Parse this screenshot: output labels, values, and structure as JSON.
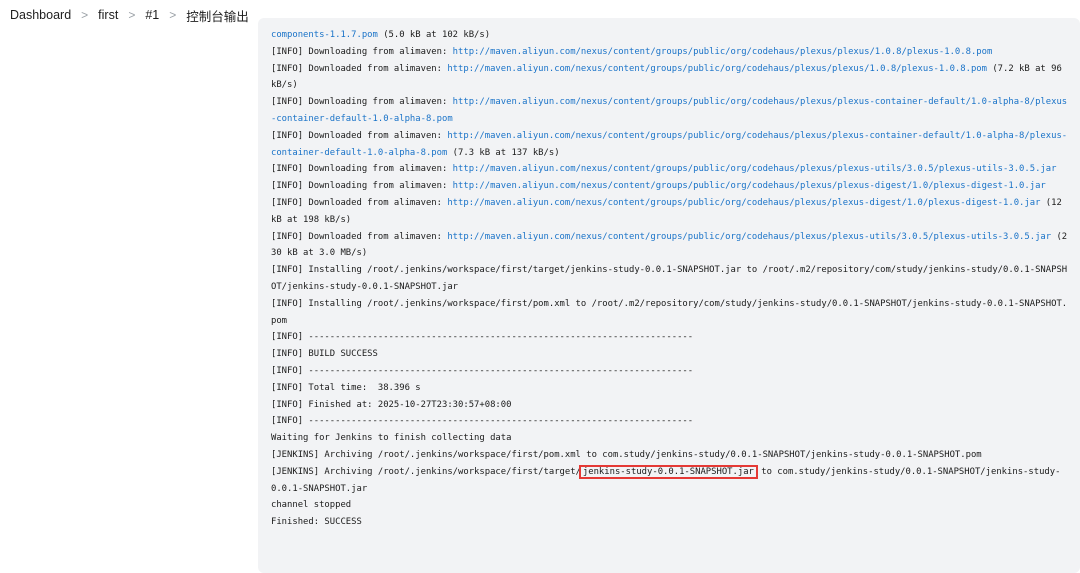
{
  "breadcrumb": {
    "items": [
      "Dashboard",
      "first",
      "#1",
      "控制台输出"
    ],
    "separator": ">"
  },
  "console": {
    "colors": {
      "text": "#1b1b1b",
      "link": "#1a73c8",
      "highlight": "#e53935",
      "panel_bg": "#f2f3f5"
    },
    "lines": [
      [
        {
          "a": "components-1.1.7.pom"
        },
        {
          "t": " (5.0 kB at 102 kB/s)"
        }
      ],
      [
        {
          "t": "[INFO] Downloading from alimaven: "
        },
        {
          "a": "http://maven.aliyun.com/nexus/content/groups/public/org/codehaus/plexus/plexus/1.0.8/plexus-1.0.8.pom"
        }
      ],
      [
        {
          "t": "[INFO] Downloaded from alimaven: "
        },
        {
          "a": "http://maven.aliyun.com/nexus/content/groups/public/org/codehaus/plexus/plexus/1.0.8/plexus-1.0.8.pom"
        },
        {
          "t": " (7.2 kB at 96 kB/s)"
        }
      ],
      [
        {
          "t": "[INFO] Downloading from alimaven: "
        },
        {
          "a": "http://maven.aliyun.com/nexus/content/groups/public/org/codehaus/plexus/plexus-container-default/1.0-alpha-8/plexus-container-default-1.0-alpha-8.pom"
        }
      ],
      [
        {
          "t": "[INFO] Downloaded from alimaven: "
        },
        {
          "a": "http://maven.aliyun.com/nexus/content/groups/public/org/codehaus/plexus/plexus-container-default/1.0-alpha-8/plexus-container-default-1.0-alpha-8.pom"
        },
        {
          "t": " (7.3 kB at 137 kB/s)"
        }
      ],
      [
        {
          "t": "[INFO] Downloading from alimaven: "
        },
        {
          "a": "http://maven.aliyun.com/nexus/content/groups/public/org/codehaus/plexus/plexus-utils/3.0.5/plexus-utils-3.0.5.jar"
        }
      ],
      [
        {
          "t": "[INFO] Downloading from alimaven: "
        },
        {
          "a": "http://maven.aliyun.com/nexus/content/groups/public/org/codehaus/plexus/plexus-digest/1.0/plexus-digest-1.0.jar"
        }
      ],
      [
        {
          "t": "[INFO] Downloaded from alimaven: "
        },
        {
          "a": "http://maven.aliyun.com/nexus/content/groups/public/org/codehaus/plexus/plexus-digest/1.0/plexus-digest-1.0.jar"
        },
        {
          "t": " (12 kB at 198 kB/s)"
        }
      ],
      [
        {
          "t": "[INFO] Downloaded from alimaven: "
        },
        {
          "a": "http://maven.aliyun.com/nexus/content/groups/public/org/codehaus/plexus/plexus-utils/3.0.5/plexus-utils-3.0.5.jar"
        },
        {
          "t": " (230 kB at 3.0 MB/s)"
        }
      ],
      [
        {
          "t": "[INFO] Installing /root/.jenkins/workspace/first/target/jenkins-study-0.0.1-SNAPSHOT.jar to /root/.m2/repository/com/study/jenkins-study/0.0.1-SNAPSHOT/jenkins-study-0.0.1-SNAPSHOT.jar"
        }
      ],
      [
        {
          "t": "[INFO] Installing /root/.jenkins/workspace/first/pom.xml to /root/.m2/repository/com/study/jenkins-study/0.0.1-SNAPSHOT/jenkins-study-0.0.1-SNAPSHOT.pom"
        }
      ],
      [
        {
          "t": "[INFO] ------------------------------------------------------------------------"
        }
      ],
      [
        {
          "t": "[INFO] BUILD SUCCESS"
        }
      ],
      [
        {
          "t": "[INFO] ------------------------------------------------------------------------"
        }
      ],
      [
        {
          "t": "[INFO] Total time:  38.396 s"
        }
      ],
      [
        {
          "t": "[INFO] Finished at: 2025-10-27T23:30:57+08:00"
        }
      ],
      [
        {
          "t": "[INFO] ------------------------------------------------------------------------"
        }
      ],
      [
        {
          "t": "Waiting for Jenkins to finish collecting data"
        }
      ],
      [
        {
          "t": "[JENKINS] Archiving /root/.jenkins/workspace/first/pom.xml to com.study/jenkins-study/0.0.1-SNAPSHOT/jenkins-study-0.0.1-SNAPSHOT.pom"
        }
      ],
      [
        {
          "t": "[JENKINS] Archiving /root/.jenkins/workspace/first/target/"
        },
        {
          "h": "jenkins-study-0.0.1-SNAPSHOT.jar"
        },
        {
          "t": " to com.study/jenkins-study/0.0.1-SNAPSHOT/jenkins-study-0.0.1-SNAPSHOT.jar"
        }
      ],
      [
        {
          "t": "channel stopped"
        }
      ],
      [
        {
          "t": "Finished: SUCCESS"
        }
      ]
    ]
  }
}
